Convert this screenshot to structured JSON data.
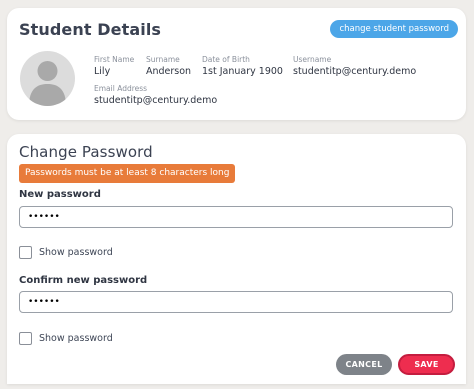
{
  "student_details": {
    "title": "Student Details",
    "change_password_button": "change student password",
    "avatar_icon": "user-silhouette",
    "fields": {
      "first_name": {
        "label": "First Name",
        "value": "Lily"
      },
      "surname": {
        "label": "Surname",
        "value": "Anderson"
      },
      "dob": {
        "label": "Date of Birth",
        "value": "1st January 1900"
      },
      "username": {
        "label": "Username",
        "value": "studentitp@century.demo"
      },
      "email": {
        "label": "Email Address",
        "value": "studentitp@century.demo"
      }
    }
  },
  "change_password": {
    "title": "Change Password",
    "warning": "Passwords must be at least 8 characters long",
    "new_password": {
      "label": "New password",
      "value": "••••••"
    },
    "show_password_1": "Show password",
    "confirm_password": {
      "label": "Confirm new password",
      "value": "••••••"
    },
    "show_password_2": "Show password",
    "cancel_label": "CANCEL",
    "save_label": "SAVE"
  },
  "colors": {
    "accent_blue": "#4ca6e8",
    "warning_orange": "#e87b3a",
    "save_red": "#ee2d4f",
    "cancel_gray": "#7e8389"
  }
}
